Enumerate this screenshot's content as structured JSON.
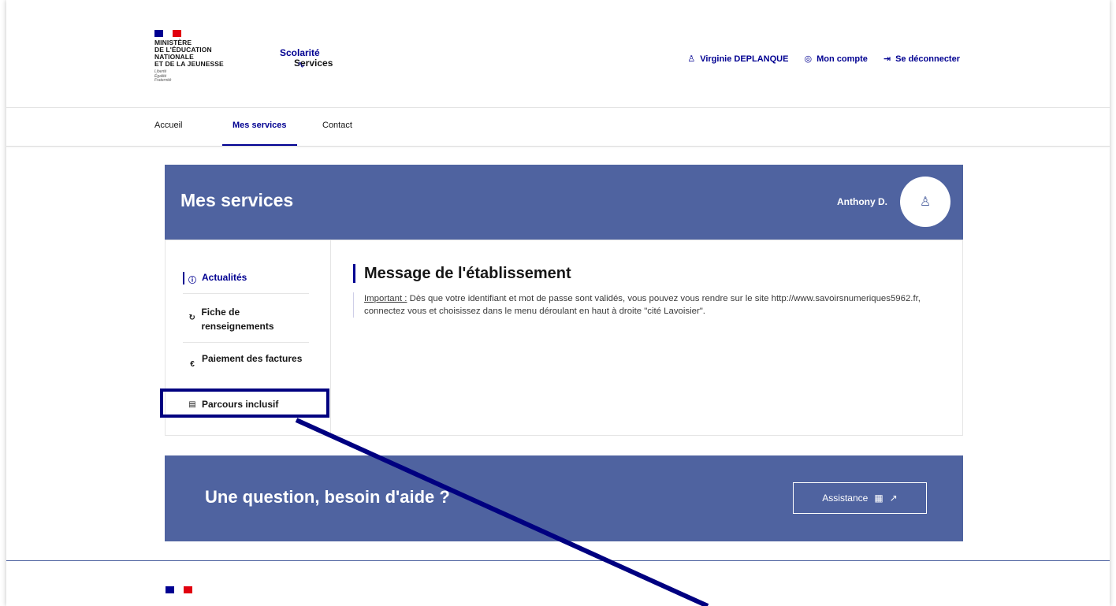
{
  "header": {
    "ministry_lines": [
      "MINISTÈRE",
      "DE L'ÉDUCATION",
      "NATIONALE",
      "ET DE LA JEUNESSE"
    ],
    "devise": [
      "Liberté",
      "Égalité",
      "Fraternité"
    ],
    "service_title_1": "Scolarité",
    "service_title_2": "Services",
    "links": [
      {
        "icon": "user-icon",
        "glyph": "♙",
        "label": "Virginie DEPLANQUE"
      },
      {
        "icon": "account-icon",
        "glyph": "◎",
        "label": "Mon compte"
      },
      {
        "icon": "logout-icon",
        "glyph": "⇥",
        "label": "Se déconnecter"
      }
    ]
  },
  "nav": {
    "items": [
      "Accueil",
      "Mes services",
      "Contact"
    ],
    "active": "Mes services"
  },
  "banner": {
    "title": "Mes services",
    "user_name": "Anthony D.",
    "avatar_icon": "user-icon"
  },
  "sidemenu": {
    "items": [
      {
        "icon": "info-icon",
        "glyph": "ⓘ",
        "label": "Actualités",
        "active": true
      },
      {
        "icon": "refresh-icon",
        "glyph": "↻",
        "label": "Fiche de renseignements"
      },
      {
        "icon": "euro-icon",
        "glyph": "€",
        "label": "Paiement des factures"
      },
      {
        "icon": "document-icon",
        "glyph": "▤",
        "label": "Parcours inclusif"
      }
    ]
  },
  "message": {
    "title": "Message de l'établissement",
    "important_label": "Important :",
    "text": " Dès que votre identifiant et mot de passe sont validés, vous pouvez vous rendre sur le site http://www.savoirsnumeriques5962.fr, connectez vous et choisissez dans le menu déroulant en haut à droite \"cité Lavoisier\"."
  },
  "help": {
    "title": "Une question, besoin d'aide ?",
    "button_label": "Assistance",
    "button_icons": [
      "assistance-icon",
      "external-link-icon"
    ]
  },
  "colors": {
    "primary": "#000091",
    "banner": "#4f63a0",
    "annotation": "#000080"
  }
}
